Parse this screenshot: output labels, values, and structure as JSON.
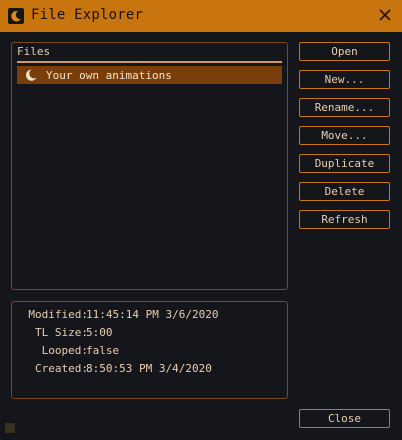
{
  "window": {
    "title": "File Explorer",
    "accent_color": "#c8740f",
    "title_icon": "moon-app-icon",
    "close_icon": "close-icon"
  },
  "files": {
    "label": "Files",
    "items": [
      {
        "label": "Your own animations",
        "icon": "moon-folder-icon",
        "selected": true
      }
    ]
  },
  "actions": {
    "open": "Open",
    "new": "New...",
    "rename": "Rename...",
    "move": "Move...",
    "duplicate": "Duplicate",
    "delete": "Delete",
    "refresh": "Refresh",
    "close": "Close"
  },
  "info": {
    "modified_label": "Modified:",
    "modified_value": "11:45:14 PM 3/6/2020",
    "tl_size_label": "TL Size:",
    "tl_size_value": "5:00",
    "looped_label": "Looped:",
    "looped_value": "false",
    "created_label": "Created:",
    "created_value": "8:50:53 PM 3/4/2020"
  }
}
